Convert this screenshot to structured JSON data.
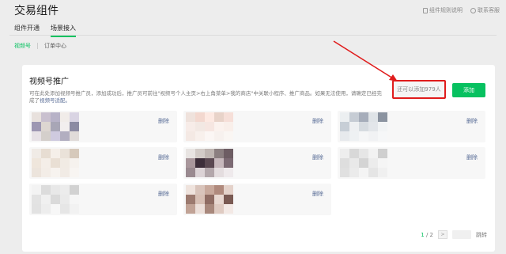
{
  "header": {
    "title": "交易组件",
    "rules_link": "组件规则说明",
    "support_link": "联系客服"
  },
  "tabs": [
    {
      "label": "组件开通",
      "active": false
    },
    {
      "label": "场景接入",
      "active": true
    }
  ],
  "subtabs": [
    {
      "label": "视频号",
      "active": true
    },
    {
      "label": "订单中心",
      "active": false
    }
  ],
  "card": {
    "title": "视频号推广",
    "desc_text": "可在此处添加视频号推广员，添加成功后，推广员可前往\"视频号个人主页>右上角菜单>我的商店\"中关联小程序、推广商品。如果无法使用，请确定已经完成了",
    "desc_link": "视频号适配。",
    "quota": "还可以添加979人",
    "add_label": "添加"
  },
  "promoters": [
    {
      "delete_label": "删除",
      "colors": [
        "#e8e1dd",
        "#c9c0cf",
        "#b7b2c7",
        "#f1ece9",
        "#d9d4e3",
        "#9d97b2",
        "#ddd6d1",
        "#a8a6b6",
        "#f2eeee",
        "#8c8ba3",
        "#e7e2e6",
        "#d4cfcb",
        "#cfcadf",
        "#b2aec0",
        "#e0dbd9"
      ]
    },
    {
      "delete_label": "删除",
      "colors": [
        "#efe2dc",
        "#f3d8cf",
        "#fde9e2",
        "#e8d3c9",
        "#f6dfd8",
        "#f7ece8",
        "#f2e8e3",
        "#f6e6e1",
        "#fbf2ee",
        "#f9efea",
        "#f4e9e4",
        "#f8f0ec",
        "#fbf6f4",
        "#f7f1ee",
        "#faf6f3"
      ]
    },
    {
      "delete_label": "删除",
      "colors": [
        "#eceff1",
        "#c6ccd4",
        "#a6adba",
        "#dfe3e7",
        "#8b93a0",
        "#c7ced6",
        "#eef0f2",
        "#d6dbe0",
        "#e3e6ea",
        "#f2f4f5",
        "#e7eaed",
        "#eef1f3",
        "#f5f6f7",
        "#f1f2f4",
        "#f6f7f8"
      ]
    },
    {
      "delete_label": "删除",
      "colors": [
        "#f0ebe6",
        "#e7ddd2",
        "#f5efe9",
        "#eae2d9",
        "#d6c9bb",
        "#efe6dc",
        "#f4eee8",
        "#e9dfd4",
        "#f1ebe4",
        "#f6f2ee",
        "#ece4dc",
        "#f3ede7",
        "#f7f3ef",
        "#f1ebe5",
        "#f8f5f2"
      ]
    },
    {
      "delete_label": "删除",
      "colors": [
        "#e8e4e2",
        "#d2cbc7",
        "#bfb6b2",
        "#8b7f80",
        "#6d5d63",
        "#a9979c",
        "#3d2e3a",
        "#5a4851",
        "#c7b8bc",
        "#7c6a73",
        "#9a8a90",
        "#dcd3d6",
        "#b3a7ab",
        "#e4dddf",
        "#efeaec"
      ]
    },
    {
      "delete_label": "删除",
      "colors": [
        "#eeeeee",
        "#d8d8d8",
        "#e6e6e6",
        "#f2f2f2",
        "#cfcfcf",
        "#dedede",
        "#e9e9e9",
        "#d4d4d4",
        "#ececec",
        "#f5f5f5",
        "#e0e0e0",
        "#ebebeb",
        "#f4f4f4",
        "#e5e5e5",
        "#f0f0f0"
      ]
    },
    {
      "delete_label": "删除",
      "colors": [
        "#f3f3f3",
        "#dcdcdc",
        "#e8e8e8",
        "#ececec",
        "#d2d2d2",
        "#e3e3e3",
        "#f0f0f0",
        "#dadada",
        "#eaeaea",
        "#f6f6f6",
        "#e2e2e2",
        "#ededed",
        "#f7f7f7",
        "#e6e6e6",
        "#f2f2f2"
      ]
    },
    {
      "delete_label": "删除",
      "colors": [
        "#efe3dd",
        "#d9c4bb",
        "#c8a99c",
        "#b08a7d",
        "#e4d2ca",
        "#9c7a6f",
        "#d7bfb4",
        "#8f6c63",
        "#e8d8d1",
        "#7a5a53",
        "#c1a396",
        "#ecdfd9",
        "#a8887c",
        "#dfcbc2",
        "#f3e9e5"
      ]
    }
  ],
  "pagination": {
    "current": "1",
    "separator": "/",
    "total": "2",
    "next_arrow": ">",
    "jump_label": "跳转"
  },
  "annotation": {
    "color": "#e01c1c"
  }
}
